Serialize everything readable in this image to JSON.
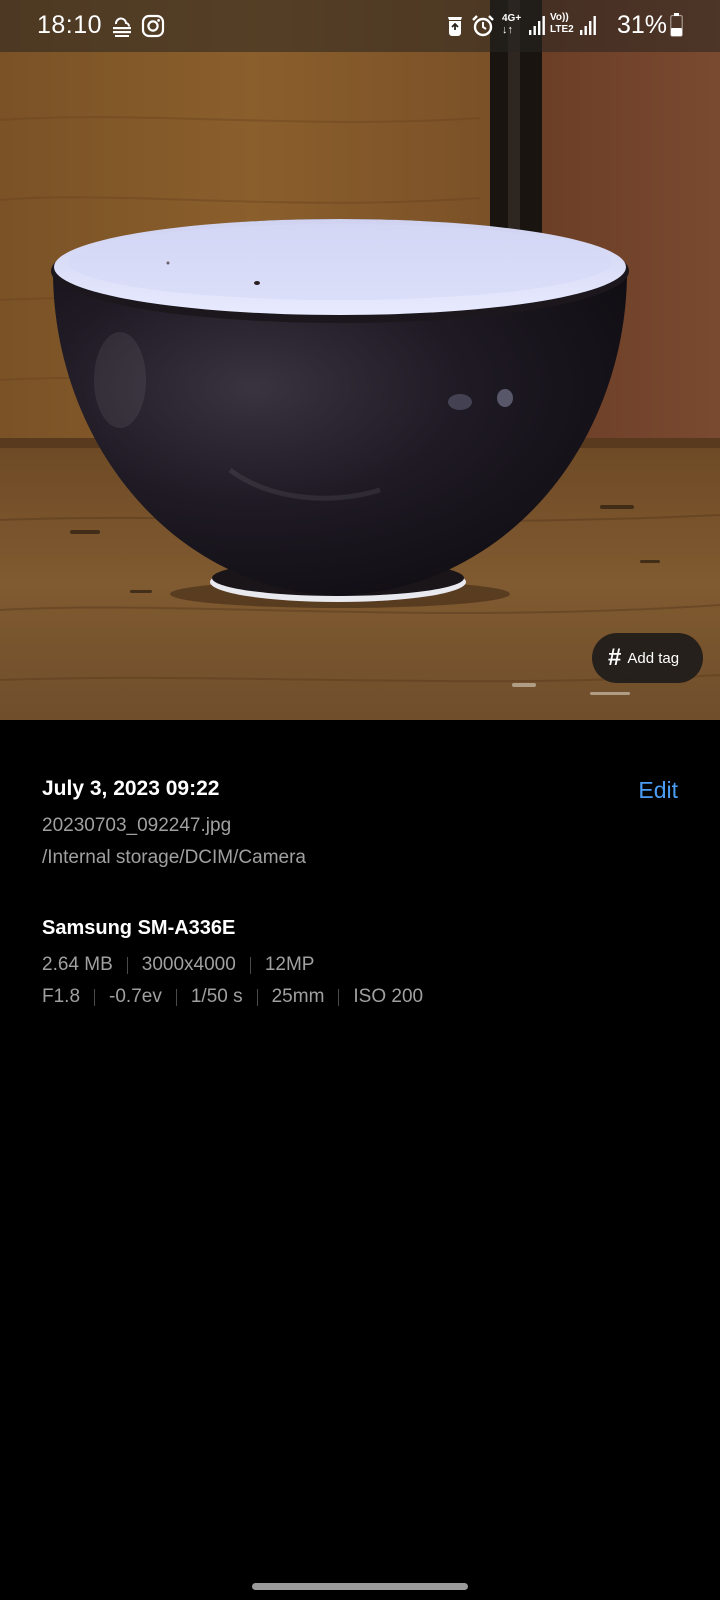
{
  "status_bar": {
    "time": "18:10",
    "battery_percent": "31%",
    "network_label": "4G+",
    "volte_label": "Vo))",
    "lte2_label": "LTE2",
    "icons": [
      "weather-icon",
      "instagram-icon",
      "recycle-icon",
      "alarm-icon",
      "data-arrows-icon",
      "signal-icon",
      "signal-icon-2",
      "battery-icon"
    ]
  },
  "photo": {
    "subject": "bowl-photo"
  },
  "add_tag": {
    "label": "Add tag",
    "icon": "hash-icon"
  },
  "details": {
    "date_time": "July 3, 2023 09:22",
    "edit_label": "Edit",
    "file_name": "20230703_092247.jpg",
    "file_path": "/Internal storage/DCIM/Camera",
    "device": "Samsung SM-A336E",
    "size": "2.64 MB",
    "resolution": "3000x4000",
    "megapixels": "12MP",
    "aperture": "F1.8",
    "exposure_bias": "-0.7ev",
    "shutter": "1/50 s",
    "focal_length": "25mm",
    "iso": "ISO 200"
  },
  "colors": {
    "accent": "#4a9cf5",
    "background": "#000000",
    "secondary_text": "#a0a0a0"
  }
}
